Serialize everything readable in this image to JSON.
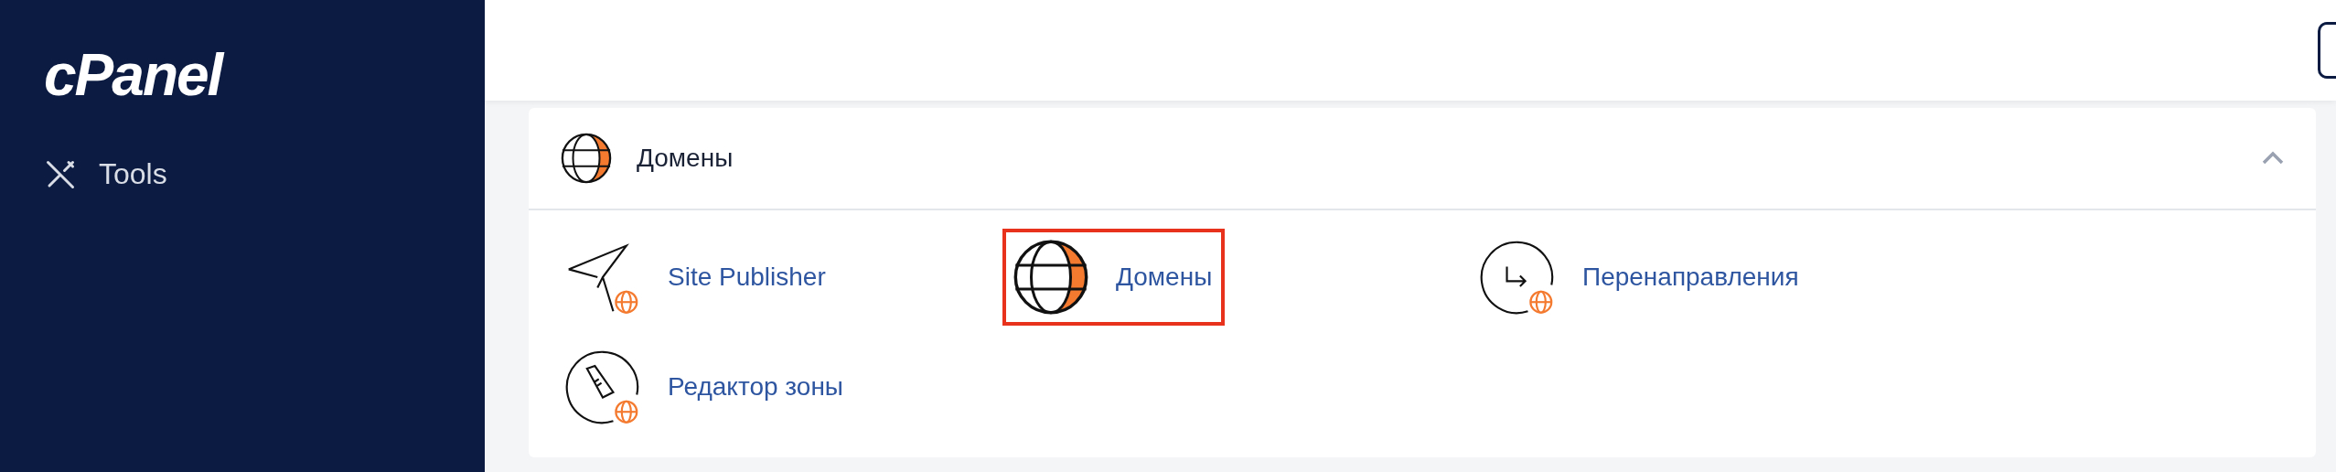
{
  "sidebar": {
    "logo": "cPanel",
    "items": [
      {
        "label": "Tools",
        "selected": false
      }
    ]
  },
  "header": {
    "search": {
      "kind": "field"
    }
  },
  "section": {
    "title": "Домены",
    "expanded": true,
    "tools": [
      {
        "label": "Site Publisher",
        "kind": "publisher",
        "selected": false
      },
      {
        "label": "Домены",
        "kind": "domains",
        "selected": true
      },
      {
        "label": "Перенаправления",
        "kind": "redirects",
        "selected": false
      },
      {
        "label": "Редактор зоны",
        "kind": "zone",
        "selected": false
      }
    ]
  }
}
